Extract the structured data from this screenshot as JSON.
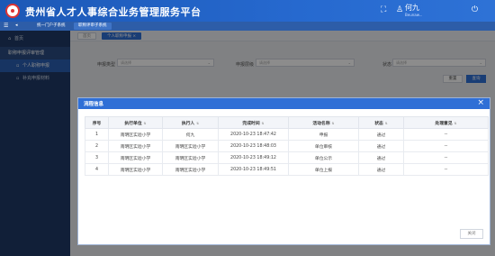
{
  "header": {
    "title": "贵州省人才人事综合业务管理服务平台",
    "user_name": "何九",
    "user_sub": "Beunaw..."
  },
  "sysbar": {
    "tabs": [
      {
        "label": "统一门户子系统"
      },
      {
        "label": "职称评审子系统"
      }
    ]
  },
  "sidebar": {
    "home": "首页",
    "group": "职称申报评审管理",
    "items": [
      {
        "label": "个人职称申报"
      },
      {
        "label": "补充申报材料"
      }
    ]
  },
  "pagetabs": [
    {
      "label": "首页"
    },
    {
      "label": "个人职称申报 ×"
    }
  ],
  "filters": [
    {
      "label": "申报类型",
      "placeholder": "请选择"
    },
    {
      "label": "申报层级",
      "placeholder": "请选择"
    },
    {
      "label": "状态",
      "placeholder": "请选择"
    }
  ],
  "buttons": {
    "reset": "重置",
    "query": "查询",
    "close": "关闭"
  },
  "modal": {
    "title": "流程信息",
    "columns": [
      "序号",
      "执行单位",
      "执行人",
      "完成时间",
      "活动名称",
      "状态",
      "处理意见"
    ],
    "rows": [
      {
        "no": "1",
        "unit": "南明区实验小学",
        "person": "何九",
        "time": "2020-10-23 18:47:42",
        "activity": "申报",
        "status": "通过",
        "opinion": "--"
      },
      {
        "no": "2",
        "unit": "南明区实验小学",
        "person": "南明区实验小学",
        "time": "2020-10-23 18:48:03",
        "activity": "单位审核",
        "status": "通过",
        "opinion": "--"
      },
      {
        "no": "3",
        "unit": "南明区实验小学",
        "person": "南明区实验小学",
        "time": "2020-10-23 18:49:12",
        "activity": "单位公示",
        "status": "通过",
        "opinion": "--"
      },
      {
        "no": "4",
        "unit": "南明区实验小学",
        "person": "南明区实验小学",
        "time": "2020-10-23 18:49:51",
        "activity": "单位上报",
        "status": "通过",
        "opinion": "--"
      }
    ]
  },
  "colors": {
    "brand": "#2669cf",
    "sidebar": "#1f3a66",
    "modal_header": "#2f6fd6"
  }
}
